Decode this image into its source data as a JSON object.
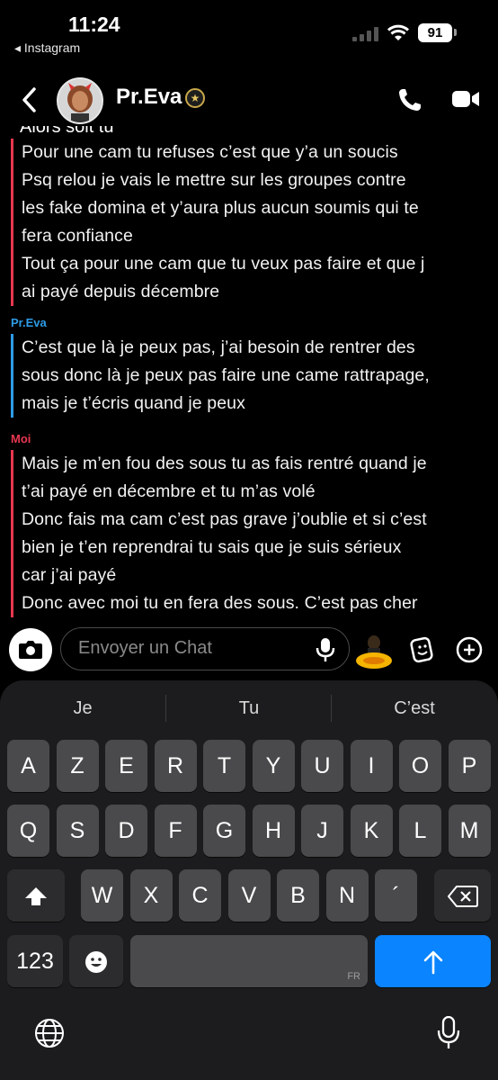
{
  "status_bar": {
    "time": "11:24",
    "back_app": "◂ Instagram",
    "battery": "91"
  },
  "header": {
    "contact_name": "Pr.Eva"
  },
  "chat": {
    "cut_off_line": "Alors soit tu",
    "messages": [
      {
        "sender": "",
        "color": "#e8374f",
        "lines": [
          "Pour une cam tu refuses c’est que y’a un soucis",
          "Psq relou je vais le mettre sur les groupes contre",
          "les fake domina et y’aura plus aucun soumis qui te",
          "fera confiance",
          "Tout ça pour une cam que tu veux pas faire et que j",
          "ai payé depuis décembre"
        ]
      },
      {
        "sender": "Pr.Eva",
        "color": "#2e9be6",
        "lines": [
          "C’est que là je peux pas, j’ai besoin de rentrer des",
          "sous donc là je peux pas faire une came rattrapage,",
          "mais je t’écris quand je peux"
        ]
      },
      {
        "sender": "Moi",
        "color": "#e8374f",
        "lines": [
          "Mais je m’en fou des sous tu as fais rentré quand je",
          "t’ai payé en décembre et tu m’as volé",
          "Donc fais ma cam c’est pas grave j’oublie et si c’est",
          "bien je t’en reprendrai tu sais que je suis sérieux",
          "car j’ai payé",
          "Donc avec moi tu en fera des sous. C’est pas cher"
        ]
      }
    ]
  },
  "composer": {
    "placeholder": "Envoyer un Chat"
  },
  "keyboard": {
    "suggestions": [
      "Je",
      "Tu",
      "C’est"
    ],
    "row1": [
      "A",
      "Z",
      "E",
      "R",
      "T",
      "Y",
      "U",
      "I",
      "O",
      "P"
    ],
    "row2": [
      "Q",
      "S",
      "D",
      "F",
      "G",
      "H",
      "J",
      "K",
      "L",
      "M"
    ],
    "row3": [
      "W",
      "X",
      "C",
      "V",
      "B",
      "N",
      "´"
    ],
    "numbers_key": "123",
    "space_lang": "FR"
  }
}
